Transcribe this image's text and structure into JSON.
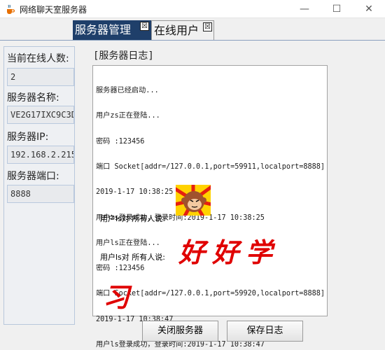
{
  "window": {
    "title": "网络聊天室服务器",
    "minimize": "—",
    "maximize": "☐",
    "close": "✕"
  },
  "tabs": [
    {
      "label": "服务器管理",
      "close": "☒",
      "selected": true
    },
    {
      "label": "在线用户",
      "close": "☒",
      "selected": false
    }
  ],
  "left_panel": {
    "online_count_label": "当前在线人数:",
    "online_count_value": "2",
    "server_name_label": "服务器名称:",
    "server_name_value": "VE2G17IXC9C3D",
    "server_ip_label": "服务器IP:",
    "server_ip_value": "192.168.2.215",
    "server_port_label": "服务器端口:",
    "server_port_value": "8888"
  },
  "log": {
    "title": "[服务器日志]",
    "lines": [
      "服务器已经启动...",
      "用户zs正在登陆...",
      "密码 :123456",
      "端口 Socket[addr=/127.0.0.1,port=59911,localport=8888]",
      "2019-1-17 10:38:25",
      "用户zs登录成功，登录时间:2019-1-17 10:38:25",
      "用户ls正在登陆...",
      "密码 :123456",
      "端口 Socket[addr=/127.0.0.1,port=59920,localport=8888]",
      "2019-1-17 10:38:47",
      "用户ls登录成功，登录时间:2019-1-17 10:38:47"
    ],
    "message_1": "用户ls对 所有人说:",
    "message_2": "用户ls对 所有人说:",
    "handwriting_1": "好好学",
    "handwriting_2": "习",
    "emoji_icon": "monkey-emoticon"
  },
  "buttons": {
    "close_server": "关闭服务器",
    "save_log": "保存日志"
  },
  "colors": {
    "tab_selected_bg": "#1f3f6a",
    "handwriting": "#e00000"
  }
}
